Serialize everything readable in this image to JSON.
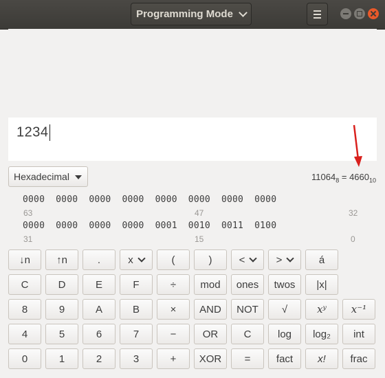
{
  "titlebar": {
    "mode_label": "Programming Mode",
    "menu_icon": "hamburger-menu-icon",
    "window_controls": [
      "minimize",
      "maximize",
      "close"
    ],
    "close_color": "#e9592a"
  },
  "display": {
    "value": "1234"
  },
  "base_select": {
    "value": "Hexadecimal"
  },
  "conversion": {
    "octal": "11064",
    "octal_sub": "8",
    "equals": " = ",
    "decimal": "4660",
    "decimal_sub": "10"
  },
  "bits": {
    "row1": "0000  0000  0000  0000  0000  0000  0000  0000",
    "row1_labels": [
      "63",
      "47",
      "32"
    ],
    "row2": "0000  0000  0000  0000  0001  0010  0011  0100",
    "row2_labels": [
      "31",
      "15",
      "0"
    ]
  },
  "annotation": {
    "arrow_color": "#d9201d"
  },
  "keypad": {
    "r1": [
      "↓n",
      "↑n",
      ".",
      "x",
      "(",
      ")",
      "<",
      ">",
      "á"
    ],
    "r2": [
      "C",
      "D",
      "E",
      "F",
      "÷",
      "mod",
      "ones",
      "twos",
      "|x|"
    ],
    "r3": [
      "8",
      "9",
      "A",
      "B",
      "×",
      "AND",
      "NOT",
      "√",
      "xʸ",
      "x⁻¹"
    ],
    "r4": [
      "4",
      "5",
      "6",
      "7",
      "−",
      "OR",
      "C",
      "log",
      "log₂",
      "int"
    ],
    "r5": [
      "0",
      "1",
      "2",
      "3",
      "+",
      "XOR",
      "=",
      "fact",
      "x!",
      "frac"
    ]
  }
}
